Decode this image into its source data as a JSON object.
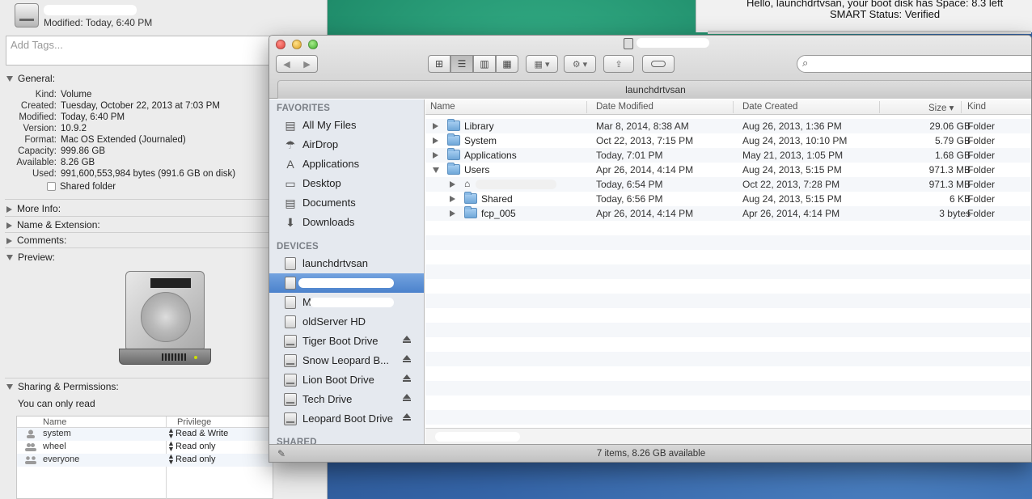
{
  "info_window": {
    "modified": "Modified: Today, 6:40 PM",
    "tags_placeholder": "Add Tags...",
    "sections": {
      "general": "General:",
      "more_info": "More Info:",
      "name_ext": "Name & Extension:",
      "comments": "Comments:",
      "preview": "Preview:",
      "sharing": "Sharing & Permissions:"
    },
    "general": [
      {
        "k": "Kind:",
        "v": "Volume"
      },
      {
        "k": "Created:",
        "v": "Tuesday, October 22, 2013 at 7:03 PM"
      },
      {
        "k": "Modified:",
        "v": "Today, 6:40 PM"
      },
      {
        "k": "Version:",
        "v": "10.9.2"
      },
      {
        "k": "Format:",
        "v": "Mac OS Extended (Journaled)"
      },
      {
        "k": "Capacity:",
        "v": "999.86 GB"
      },
      {
        "k": "Available:",
        "v": "8.26 GB"
      },
      {
        "k": "Used:",
        "v": "991,600,553,984 bytes (991.6 GB on disk)"
      }
    ],
    "shared_folder": "Shared folder",
    "only_read": "You can only read",
    "perm_headers": {
      "name": "Name",
      "privilege": "Privilege"
    },
    "permissions": [
      {
        "name": "system",
        "privilege": "Read & Write"
      },
      {
        "name": "wheel",
        "privilege": "Read only"
      },
      {
        "name": "everyone",
        "privilege": "Read only"
      }
    ]
  },
  "top_status": {
    "line1": "Hello, launchdrtvsan, your boot disk has Space: 8.3 left",
    "line2": "SMART Status: Verified"
  },
  "finder": {
    "tab_title": "launchdrtvsan",
    "sidebar": {
      "favorites_head": "FAVORITES",
      "favorites": [
        {
          "label": "All My Files",
          "icon": "all-files-icon",
          "glyph": "▤"
        },
        {
          "label": "AirDrop",
          "icon": "airdrop-icon",
          "glyph": "☂"
        },
        {
          "label": "Applications",
          "icon": "applications-icon",
          "glyph": "A"
        },
        {
          "label": "Desktop",
          "icon": "desktop-icon",
          "glyph": "▭"
        },
        {
          "label": "Documents",
          "icon": "documents-icon",
          "glyph": "▤"
        },
        {
          "label": "Downloads",
          "icon": "downloads-icon",
          "glyph": "⬇"
        }
      ],
      "devices_head": "DEVICES",
      "devices": [
        {
          "label": "launchdrtvsan"
        },
        {
          "label": ""
        },
        {
          "label": "M"
        },
        {
          "label": "oldServer HD"
        },
        {
          "label": "Tiger Boot Drive"
        },
        {
          "label": "Snow Leopard B..."
        },
        {
          "label": "Lion Boot Drive"
        },
        {
          "label": "Tech Drive"
        },
        {
          "label": "Leopard Boot Drive"
        }
      ],
      "shared_head": "SHARED"
    },
    "columns": {
      "name": "Name",
      "modified": "Date Modified",
      "created": "Date Created",
      "size": "Size ▾",
      "kind": "Kind"
    },
    "rows": [
      {
        "name": "Library",
        "modified": "Mar 8, 2014, 8:38 AM",
        "created": "Aug 26, 2013, 1:36 PM",
        "size": "29.06 GB",
        "kind": "Folder"
      },
      {
        "name": "System",
        "modified": "Oct 22, 2013, 7:15 PM",
        "created": "Aug 24, 2013, 10:10 PM",
        "size": "5.79 GB",
        "kind": "Folder"
      },
      {
        "name": "Applications",
        "modified": "Today, 7:01 PM",
        "created": "May 21, 2013, 1:05 PM",
        "size": "1.68 GB",
        "kind": "Folder"
      },
      {
        "name": "Users",
        "modified": "Apr 26, 2014, 4:14 PM",
        "created": "Aug 24, 2013, 5:15 PM",
        "size": "971.3 MB",
        "kind": "Folder"
      },
      {
        "name": "",
        "modified": "Today, 6:54 PM",
        "created": "Oct 22, 2013, 7:28 PM",
        "size": "971.3 MB",
        "kind": "Folder"
      },
      {
        "name": "Shared",
        "modified": "Today, 6:56 PM",
        "created": "Aug 24, 2013, 5:15 PM",
        "size": "6 KB",
        "kind": "Folder"
      },
      {
        "name": "fcp_005",
        "modified": "Apr 26, 2014, 4:14 PM",
        "created": "Apr 26, 2014, 4:14 PM",
        "size": "3 bytes",
        "kind": "Folder"
      }
    ],
    "status": "7 items, 8.26 GB available"
  }
}
